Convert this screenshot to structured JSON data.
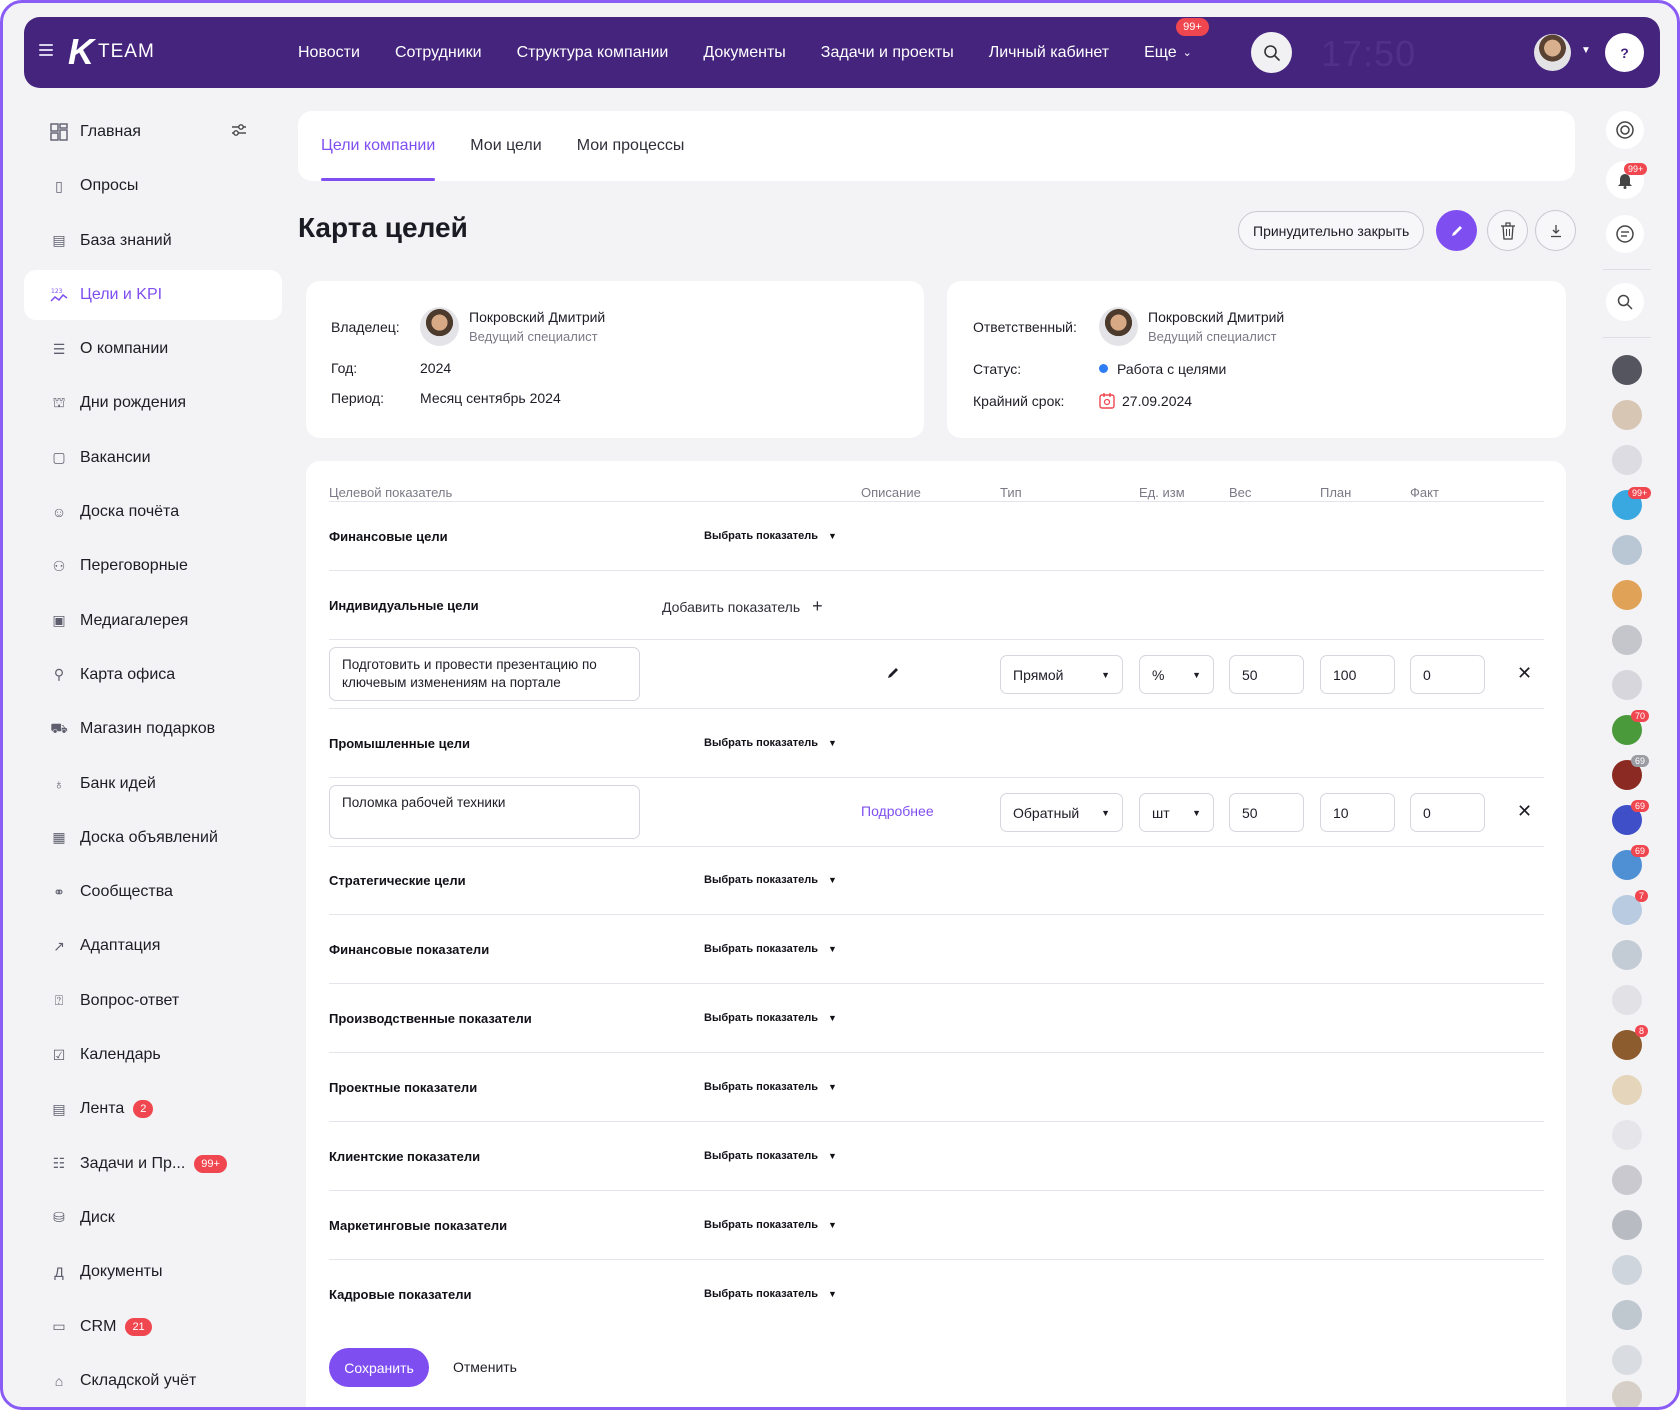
{
  "brand": {
    "logo_mark": "K",
    "logo_text": "TEAM"
  },
  "topnav": {
    "items": [
      "Новости",
      "Сотрудники",
      "Структура компании",
      "Документы",
      "Задачи и проекты",
      "Личный кабинет"
    ],
    "more_label": "Еще",
    "more_badge": "99+",
    "time": "17:50"
  },
  "sidebar": {
    "items": [
      {
        "label": "Главная",
        "icon": "dashboard-icon"
      },
      {
        "label": "Опросы",
        "icon": "survey-icon"
      },
      {
        "label": "База знаний",
        "icon": "book-icon"
      },
      {
        "label": "Цели и KPI",
        "icon": "kpi-icon",
        "active": true
      },
      {
        "label": "О компании",
        "icon": "company-icon"
      },
      {
        "label": "Дни рождения",
        "icon": "cake-icon"
      },
      {
        "label": "Вакансии",
        "icon": "vacancy-icon"
      },
      {
        "label": "Доска почёта",
        "icon": "honor-icon"
      },
      {
        "label": "Переговорные",
        "icon": "meeting-icon"
      },
      {
        "label": "Медиагалерея",
        "icon": "gallery-icon"
      },
      {
        "label": "Карта офиса",
        "icon": "map-pin-icon"
      },
      {
        "label": "Магазин подарков",
        "icon": "cart-icon"
      },
      {
        "label": "Банк идей",
        "icon": "bulb-icon"
      },
      {
        "label": "Доска объявлений",
        "icon": "board-icon"
      },
      {
        "label": "Сообщества",
        "icon": "people-icon"
      },
      {
        "label": "Адаптация",
        "icon": "arrow-icon"
      },
      {
        "label": "Вопрос-ответ",
        "icon": "faq-icon"
      },
      {
        "label": "Календарь",
        "icon": "calendar-icon"
      },
      {
        "label": "Лента",
        "icon": "feed-icon",
        "badge": "2"
      },
      {
        "label": "Задачи и Пр...",
        "icon": "tasks-icon",
        "badge": "99+"
      },
      {
        "label": "Диск",
        "icon": "disk-icon"
      },
      {
        "label": "Документы",
        "icon": "docs-icon",
        "glyph": "Д"
      },
      {
        "label": "CRM",
        "icon": "crm-icon",
        "badge": "21"
      },
      {
        "label": "Складской учёт",
        "icon": "warehouse-icon"
      }
    ]
  },
  "tabs": [
    "Цели компании",
    "Мои цели",
    "Мои процессы"
  ],
  "page": {
    "title": "Карта целей",
    "force_close": "Принудительно закрыть"
  },
  "owner_card": {
    "owner_label": "Владелец:",
    "owner_name": "Покровский Дмитрий",
    "owner_role": "Ведущий специалист",
    "year_label": "Год:",
    "year": "2024",
    "period_label": "Период:",
    "period": "Месяц сентябрь 2024"
  },
  "resp_card": {
    "resp_label": "Ответственный:",
    "resp_name": "Покровский Дмитрий",
    "resp_role": "Ведущий специалист",
    "status_label": "Статус:",
    "status": "Работа с целями",
    "deadline_label": "Крайний срок:",
    "deadline": "27.09.2024"
  },
  "table": {
    "headers": {
      "indicator": "Целевой показатель",
      "description": "Описание",
      "type": "Тип",
      "unit": "Ед. изм",
      "weight": "Вес",
      "plan": "План",
      "fact": "Факт"
    },
    "pick_label": "Выбрать показатель",
    "add_label": "Добавить показатель",
    "groups": [
      "Финансовые цели",
      "Индивидуальные цели",
      "Промышленные цели",
      "Стратегические цели",
      "Финансовые показатели",
      "Производственные показатели",
      "Проектные показатели",
      "Клиентские показатели",
      "Маркетинговые показатели",
      "Кадровые показатели"
    ],
    "rows": [
      {
        "text": "Подготовить и провести презентацию по ключевым изменениям на портале",
        "type": "Прямой",
        "unit": "%",
        "weight": "50",
        "plan": "100",
        "fact": "0"
      },
      {
        "text": "Поломка рабочей техники",
        "link": "Подробнее",
        "type": "Обратный",
        "unit": "шт",
        "weight": "50",
        "plan": "10",
        "fact": "0"
      }
    ]
  },
  "actions": {
    "save": "Сохранить",
    "cancel": "Отменить"
  },
  "rail": {
    "bell_badge": "99+",
    "avatar_badges": [
      "99+",
      "70",
      "69",
      "69",
      "69",
      "7",
      "8"
    ]
  },
  "colors": {
    "primary": "#7f4ef0",
    "topbar": "#45247e",
    "badge": "#f0464f",
    "status_dot": "#2f7df6"
  }
}
